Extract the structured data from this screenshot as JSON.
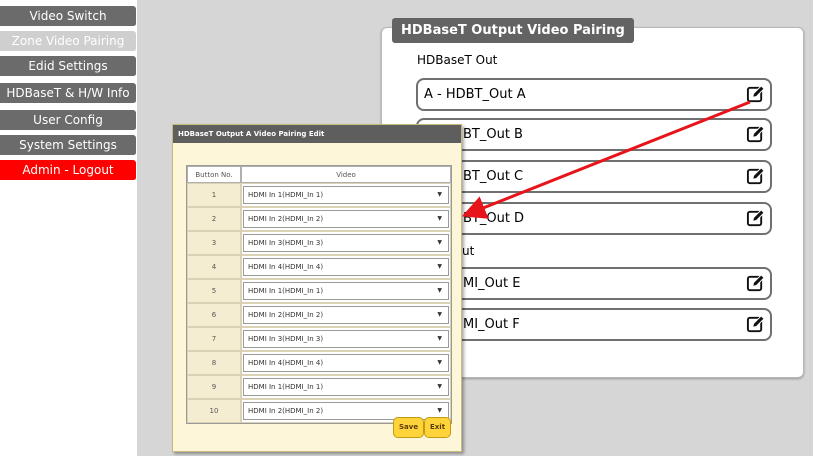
{
  "sidebar": {
    "items": [
      {
        "label": "Video Switch",
        "state": "normal"
      },
      {
        "label": "Zone Video Pairing",
        "state": "active"
      },
      {
        "label": "Edid Settings",
        "state": "normal"
      },
      {
        "label": "HDBaseT & H/W Info",
        "state": "normal"
      },
      {
        "label": "User Config",
        "state": "normal"
      },
      {
        "label": "System Settings",
        "state": "normal"
      },
      {
        "label": "Admin - Logout",
        "state": "logout"
      }
    ]
  },
  "panel": {
    "title": "HDBaseT Output Video Pairing",
    "hdbt_section_label": "HDBaseT Out",
    "hdmi_section_label": "ut",
    "outputs": [
      {
        "label": "A - HDBT_Out A"
      },
      {
        "label": "BT_Out B"
      },
      {
        "label": "BT_Out C"
      },
      {
        "label": "BT_Out D"
      },
      {
        "label": "MI_Out E"
      },
      {
        "label": "MI_Out F"
      }
    ]
  },
  "dialog": {
    "title": "HDBaseT Output A Video Pairing Edit",
    "col_button": "Button No.",
    "col_video": "Video",
    "rows": [
      {
        "num": "1",
        "video": "HDMI In 1(HDMI_In 1)"
      },
      {
        "num": "2",
        "video": "HDMI In 2(HDMI_In 2)"
      },
      {
        "num": "3",
        "video": "HDMI In 3(HDMI_In 3)"
      },
      {
        "num": "4",
        "video": "HDMI In 4(HDMI_In 4)"
      },
      {
        "num": "5",
        "video": "HDMI In 1(HDMI_In 1)"
      },
      {
        "num": "6",
        "video": "HDMI In 2(HDMI_In 2)"
      },
      {
        "num": "7",
        "video": "HDMI In 3(HDMI_In 3)"
      },
      {
        "num": "8",
        "video": "HDMI In 4(HDMI_In 4)"
      },
      {
        "num": "9",
        "video": "HDMI In 1(HDMI_In 1)"
      },
      {
        "num": "10",
        "video": "HDMI In 2(HDMI_In 2)"
      }
    ],
    "save_label": "Save",
    "exit_label": "Exit"
  },
  "colors": {
    "nav_bg": "#6b6b6b",
    "nav_active": "#cfcfcf",
    "logout": "#ff0000",
    "dialog_bg": "#fdf6d8",
    "button_yellow": "#ffd43a",
    "annotation_arrow": "#e8141c"
  },
  "icons": {
    "edit": "edit-pencil-icon",
    "dropdown": "dropdown-arrow-icon"
  }
}
